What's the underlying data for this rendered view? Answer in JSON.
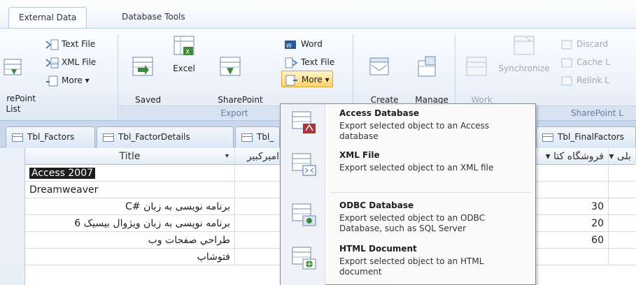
{
  "ribbon": {
    "tabs": [
      "External Data",
      "Database Tools"
    ],
    "import_group": {
      "partial_label": "rePoint\nList",
      "text_file": "Text File",
      "xml_file": "XML File",
      "more": "More ▾"
    },
    "export_group": {
      "label": "Export",
      "saved_exports": "Saved\nExports",
      "excel": "Excel",
      "sharepoint_list": "SharePoint\nList",
      "word": "Word",
      "text_file": "Text File",
      "more": "More ▾"
    },
    "collect_group": {
      "create_email": "Create\nE-mail",
      "manage_replies": "Manage\nReplies"
    },
    "sharepoint_group": {
      "label": "SharePoint L",
      "work_online": "Work\nOnline",
      "synchronize": "Synchronize",
      "discard": "Discard",
      "cache": "Cache L",
      "relink": "Relink L"
    }
  },
  "object_tabs": [
    "Tbl_Factors",
    "Tbl_FactorDetails",
    "Tbl_",
    "Tbl_FinalFactors"
  ],
  "datasheet": {
    "headers": {
      "title": "Title",
      "col2": "امیرکبیر",
      "col3": "فروشگاه کتا",
      "col4": "بلی"
    },
    "rows": [
      {
        "title": "Access 2007",
        "value": ""
      },
      {
        "title": "Dreamweaver",
        "value": ""
      },
      {
        "title": "برنامه نویسی به زبان #C",
        "value": "30"
      },
      {
        "title": "برنامه نویسی به زبان ویژوال بیسیک 6",
        "value": "20"
      },
      {
        "title": "طراحي صفحات وب",
        "value": "60"
      },
      {
        "title": "فتوشاپ",
        "value": ""
      }
    ]
  },
  "export_menu": {
    "items": [
      {
        "title": "Access Database",
        "desc": "Export selected object to an Access database"
      },
      {
        "title": "XML File",
        "desc": "Export selected object to an XML file"
      },
      {
        "title": "ODBC Database",
        "desc": "Export selected object to an ODBC Database, such as SQL Server"
      },
      {
        "title": "HTML Document",
        "desc": "Export selected object to an HTML document"
      }
    ]
  }
}
